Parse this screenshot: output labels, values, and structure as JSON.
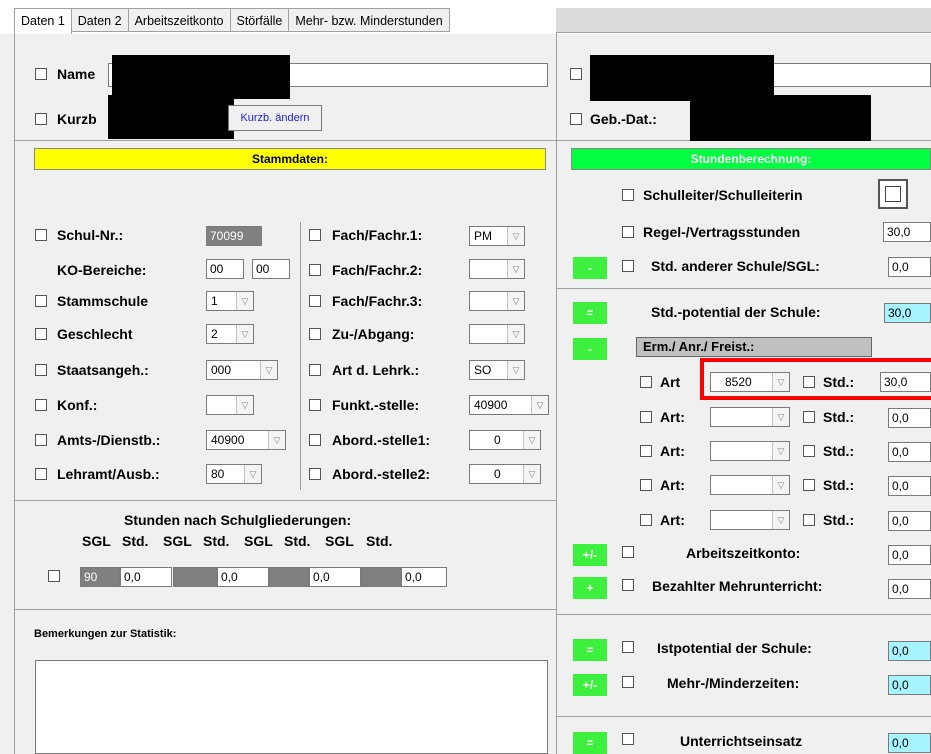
{
  "tabs": [
    {
      "label": "Daten 1"
    },
    {
      "label": "Daten 2"
    },
    {
      "label": "Arbeitszeitkonto"
    },
    {
      "label": "Störfälle"
    },
    {
      "label": "Mehr- bzw. Minderstunden"
    }
  ],
  "top": {
    "name_label": "Name",
    "kurzb_label": "Kurzb",
    "kurzb_btn": "Kurzb. ändern",
    "gebdat_label": "Geb.-Dat.:"
  },
  "stammdaten": {
    "header": "Stammdaten:",
    "schulnr_label": "Schul-Nr.:",
    "schulnr_value": "70099",
    "ko_label": "KO-Bereiche:",
    "ko_value1": "00",
    "ko_value2": "00",
    "stammschule_label": "Stammschule",
    "stammschule_value": "1",
    "geschlecht_label": "Geschlecht",
    "geschlecht_value": "2",
    "staatsangeh_label": "Staatsangeh.:",
    "staatsangeh_value": "000",
    "konf_label": "Konf.:",
    "konf_value": "",
    "amts_label": "Amts-/Dienstb.:",
    "amts_value": "40900",
    "lehramt_label": "Lehramt/Ausb.:",
    "lehramt_value": "80",
    "fach1_label": "Fach/Fachr.1:",
    "fach1_value": "PM",
    "fach2_label": "Fach/Fachr.2:",
    "fach2_value": "",
    "fach3_label": "Fach/Fachr.3:",
    "fach3_value": "",
    "zuab_label": "Zu-/Abgang:",
    "zuab_value": "",
    "artlehrk_label": "Art d. Lehrk.:",
    "artlehrk_value": "SO",
    "funkt_label": "Funkt.-stelle:",
    "funkt_value": "40900",
    "abord1_label": "Abord.-stelle1:",
    "abord1_value": "0",
    "abord2_label": "Abord.-stelle2:",
    "abord2_value": "0"
  },
  "schulgliederungen": {
    "title": "Stunden nach Schulgliederungen:",
    "headers": [
      "SGL",
      "Std.",
      "SGL",
      "Std.",
      "SGL",
      "Std.",
      "SGL",
      "Std."
    ],
    "values": [
      {
        "sgl": "90",
        "std": "0,0"
      },
      {
        "sgl": "",
        "std": "0,0"
      },
      {
        "sgl": "",
        "std": "0,0"
      },
      {
        "sgl": "",
        "std": "0,0"
      }
    ]
  },
  "bemerkungen": {
    "label": "Bemerkungen zur Statistik:",
    "text": ""
  },
  "stundenberechnung": {
    "header": "Stundenberechnung:",
    "schulleiter_label": "Schulleiter/Schulleiterin",
    "regel_label": "Regel-/Vertragsstunden",
    "regel_value": "30,0",
    "anderer_label": "Std. anderer Schule/SGL:",
    "anderer_value": "0,0",
    "potential_label": "Std.-potential der Schule:",
    "potential_value": "30,0",
    "erm_label": "Erm./ Anr./ Freist.:",
    "art_label": "Art",
    "art_label_colon": "Art:",
    "std_label": "Std.:",
    "art_rows": [
      {
        "art": "8520",
        "std": "30,0"
      },
      {
        "art": "",
        "std": "0,0"
      },
      {
        "art": "",
        "std": "0,0"
      },
      {
        "art": "",
        "std": "0,0"
      },
      {
        "art": "",
        "std": "0,0"
      }
    ],
    "arbeitszeitkonto_label": "Arbeitszeitkonto:",
    "arbeitszeitkonto_value": "0,0",
    "bezahlter_label": "Bezahlter Mehrunterricht:",
    "bezahlter_value": "0,0",
    "istpotential_label": "Istpotential der Schule:",
    "istpotential_value": "0,0",
    "mehrminder_label": "Mehr-/Minderzeiten:",
    "mehrminder_value": "0,0",
    "unterricht_label": "Unterrichtseinsatz",
    "unterricht_value": "0,0"
  },
  "ops": {
    "minus": "-",
    "equals": "=",
    "plusminus": "+/-",
    "plus": "+"
  },
  "colors": {
    "stammdaten_header": "#ffff00",
    "stunden_header": "#00ff40",
    "op_button": "#3ef03e",
    "highlight": "#ff0000",
    "cyan_field": "#a6f4ff"
  }
}
